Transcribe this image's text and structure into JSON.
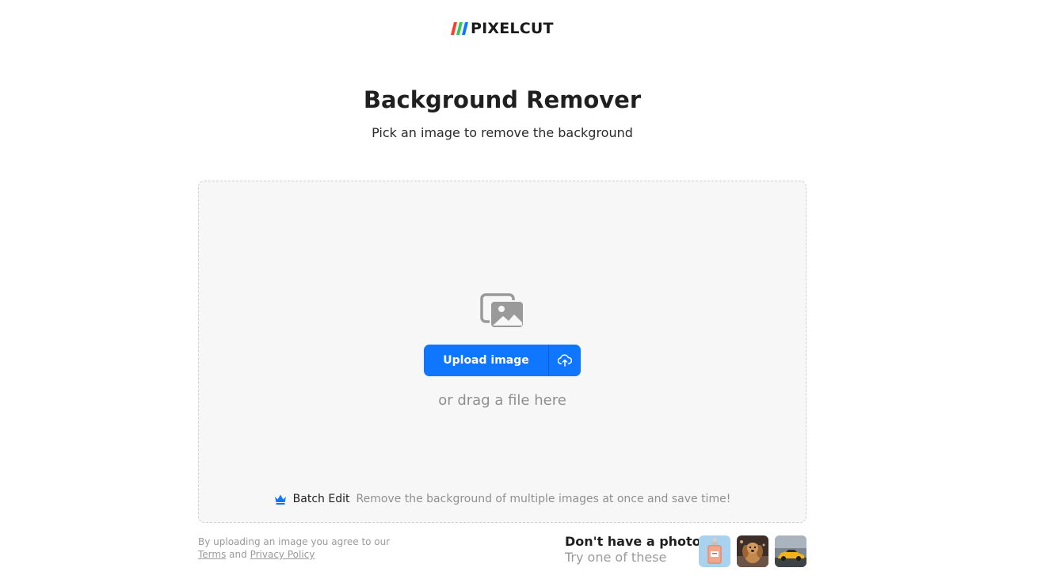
{
  "brand": {
    "name": "PIXELCUT",
    "stripe_colors": [
      "#ff3b30",
      "#34c759",
      "#0f76ff"
    ]
  },
  "hero": {
    "title": "Background Remover",
    "subtitle": "Pick an image to remove the background"
  },
  "dropzone": {
    "icon": "photos-icon",
    "upload_label": "Upload image",
    "upload_icon": "cloud-upload-icon",
    "drag_text": "or drag a file here",
    "batch_icon": "crown-icon",
    "batch_label": "Batch Edit",
    "batch_description": "Remove the background of multiple images at once and save time!"
  },
  "footer": {
    "legal_prefix": "By uploading an image you agree to our",
    "terms_label": "Terms",
    "and_text": "and",
    "privacy_label": "Privacy Policy",
    "sample_title": "Don't have a photo?",
    "sample_subtitle": "Try one of these",
    "samples": [
      "perfume-bottle-sample",
      "dog-sample",
      "car-sample"
    ]
  },
  "colors": {
    "accent": "#0f76ff",
    "muted_text": "#8f8f8f",
    "dropzone_bg": "#f7f7f7"
  }
}
